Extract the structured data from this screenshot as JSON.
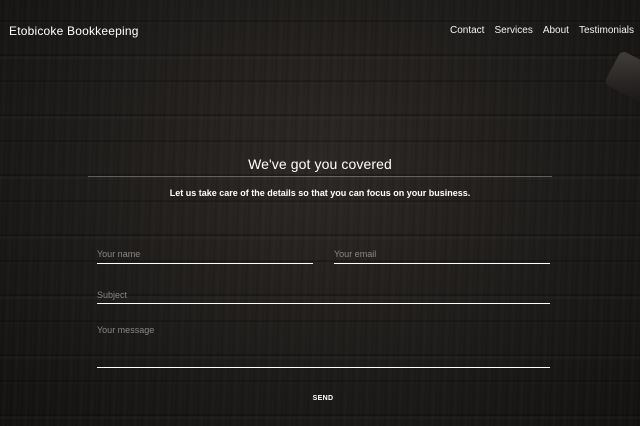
{
  "header": {
    "brand": "Etobicoke Bookkeeping",
    "nav": [
      {
        "label": "Contact"
      },
      {
        "label": "Services"
      },
      {
        "label": "About"
      },
      {
        "label": "Testimonials"
      }
    ]
  },
  "hero": {
    "title": "We've got you covered",
    "subtitle": "Let us take care of the details so that you can focus on your business."
  },
  "form": {
    "name_placeholder": "Your name",
    "email_placeholder": "Your email",
    "subject_placeholder": "Subject",
    "message_placeholder": "Your message",
    "send_label": "SEND"
  },
  "colors": {
    "text": "#ffffff",
    "placeholder": "#8a8784",
    "background": "#1c1a18"
  }
}
